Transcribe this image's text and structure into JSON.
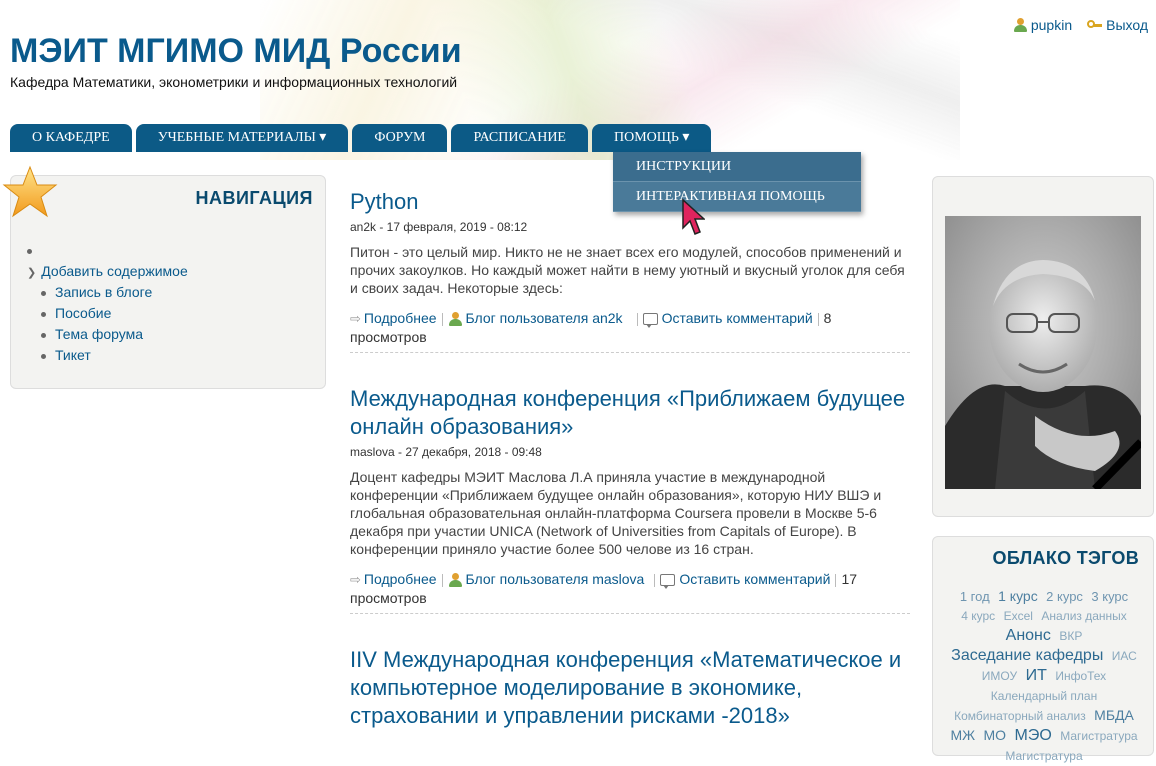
{
  "site": {
    "title": "МЭИТ МГИМО МИД России",
    "slogan": "Кафедра Математики, эконометрики и информационных технологий"
  },
  "user_bar": {
    "username": "pupkin",
    "logout": "Выход"
  },
  "menu": {
    "items": [
      {
        "label": "О КАФЕДРЕ"
      },
      {
        "label": "УЧЕБНЫЕ МАТЕРИАЛЫ ▾"
      },
      {
        "label": "ФОРУМ"
      },
      {
        "label": "РАСПИСАНИЕ"
      },
      {
        "label": "ПОМОЩЬ ▾"
      }
    ],
    "help_dropdown": [
      {
        "label": "ИНСТРУКЦИИ"
      },
      {
        "label": "ИНТЕРАКТИВНАЯ ПОМОЩЬ"
      }
    ]
  },
  "navigation": {
    "title": "НАВИГАЦИЯ",
    "add_content": "Добавить содержимое",
    "sub_items": [
      "Запись в блоге",
      "Пособие",
      "Тема форума",
      "Тикет"
    ]
  },
  "nodes": [
    {
      "title": "Python",
      "meta": "an2k - 17 февраля, 2019 - 08:12",
      "body": "Питон - это целый мир. Никто не не знает всех его модулей, способов применений и прочих закоулков. Но каждый может найти в нему уютный и вкусный уголок для себя и своих задач. Некоторые здесь:",
      "more": "Подробнее",
      "blog": "Блог пользователя an2k",
      "comment": "Оставить комментарий",
      "views": "8",
      "views_label": "просмотров"
    },
    {
      "title": "Международная конференция «Приближаем будущее онлайн образования»",
      "meta": "maslova - 27 декабря, 2018 - 09:48",
      "body": "Доцент кафедры МЭИТ Маслова Л.А приняла участие в международной конференции «Приближаем будущее онлайн образования», которую НИУ ВШЭ и глобальная образовательная онлайн-платформа Coursera провели в Москве 5-6 декабря при участии UNICA (Network of Universities from Capitals of Europe). В конференции приняло участие более 500 челове из 16 стран.",
      "more": "Подробнее",
      "blog": "Блог пользователя maslova",
      "comment": "Оставить комментарий",
      "views": "17",
      "views_label": "просмотров"
    },
    {
      "title": "IIV Международная конференция «Математическое и компьютерное моделирование в экономике, страховании и управлении рисками -2018»"
    }
  ],
  "tag_cloud": {
    "title": "ОБЛАКО ТЭГОВ",
    "tags": [
      {
        "label": "1 год",
        "size": "t2"
      },
      {
        "label": "1 курс",
        "size": "t3"
      },
      {
        "label": "2 курс",
        "size": "t2"
      },
      {
        "label": "3 курс",
        "size": "t2"
      },
      {
        "label": "4 курс",
        "size": "t1"
      },
      {
        "label": "Excel",
        "size": "t1"
      },
      {
        "label": "Анализ данных",
        "size": "t1"
      },
      {
        "label": "Анонс",
        "size": "t4"
      },
      {
        "label": "ВКР",
        "size": "t1"
      },
      {
        "label": "Заседание кафедры",
        "size": "t4"
      },
      {
        "label": "ИАС",
        "size": "t1"
      },
      {
        "label": "ИМОУ",
        "size": "t1"
      },
      {
        "label": "ИТ",
        "size": "t4"
      },
      {
        "label": "ИнфоТех",
        "size": "t1"
      },
      {
        "label": "Календарный план",
        "size": "t1"
      },
      {
        "label": "Комбинаторный анализ",
        "size": "t1"
      },
      {
        "label": "МБДА",
        "size": "t3"
      },
      {
        "label": "МЖ",
        "size": "t3"
      },
      {
        "label": "МО",
        "size": "t3"
      },
      {
        "label": "МЭО",
        "size": "t4"
      },
      {
        "label": "Магистратура",
        "size": "t1"
      },
      {
        "label": "Магистратура",
        "size": "t1"
      }
    ]
  }
}
